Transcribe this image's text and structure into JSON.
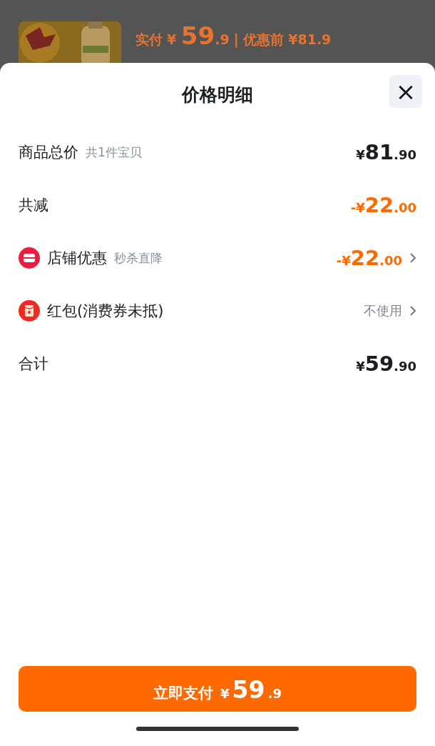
{
  "background": {
    "paid_label": "实付",
    "paid_currency": "¥",
    "paid_integer": "59",
    "paid_decimal": ".9",
    "divider": "|",
    "original_label": "优惠前",
    "original_price": "¥81.9"
  },
  "sheet": {
    "title": "价格明细",
    "close": "×"
  },
  "rows": [
    {
      "kind": "plain",
      "label": "商品总价",
      "note": "共1件宝贝",
      "value": {
        "kind": "price",
        "currency": "¥",
        "integer": "81",
        "decimal": ".90"
      },
      "chevron": false
    },
    {
      "kind": "plain",
      "label": "共减",
      "value": {
        "kind": "discount",
        "sign": "-",
        "currency": "¥",
        "integer": "22",
        "decimal": ".00"
      },
      "chevron": false
    },
    {
      "kind": "store",
      "label": "店铺优惠",
      "note": "秒杀直降",
      "value": {
        "kind": "discount",
        "sign": "-",
        "currency": "¥",
        "integer": "22",
        "decimal": ".00"
      },
      "chevron": true
    },
    {
      "kind": "coupon",
      "label": "红包(消费券未抵)",
      "value": {
        "kind": "text",
        "text": "不使用"
      },
      "chevron": true
    },
    {
      "kind": "plain",
      "label": "合计",
      "value": {
        "kind": "price",
        "currency": "¥",
        "integer": "59",
        "decimal": ".90"
      },
      "chevron": false
    }
  ],
  "pay_button": {
    "label": "立即支付",
    "currency": "¥",
    "integer": "59",
    "decimal": ".9"
  }
}
